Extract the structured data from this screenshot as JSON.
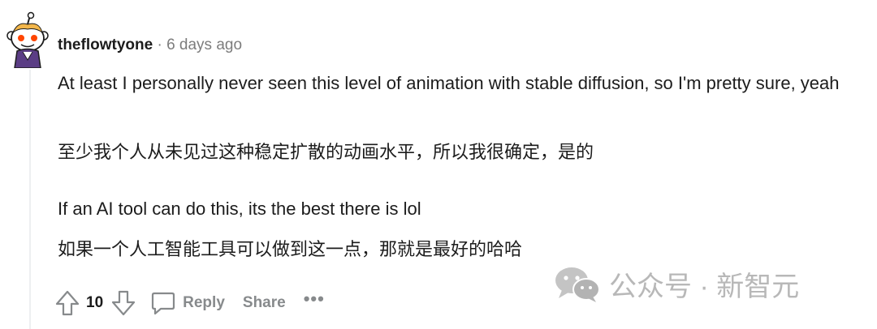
{
  "comment": {
    "author": "theflowtyone",
    "separator": "·",
    "time": "6 days ago",
    "body": [
      "At least I personally never seen this level of animation with stable diffusion, so I'm pretty sure, yeah",
      "至少我个人从未见过这种稳定扩散的动画水平，所以我很确定，是的",
      "If an AI tool can do this, its the best there is lol",
      "如果一个人工智能工具可以做到这一点，那就是最好的哈哈"
    ],
    "score": "10",
    "actions": {
      "reply": "Reply",
      "share": "Share",
      "more": "•••"
    }
  },
  "watermark": {
    "text": "公众号 · 新智元",
    "icon": "wechat-logo"
  },
  "colors": {
    "text": "#1c1c1c",
    "muted": "#7c7c7c",
    "action": "#878a8c",
    "thread_line": "#edeff1",
    "watermark": "#b8b8b8"
  }
}
